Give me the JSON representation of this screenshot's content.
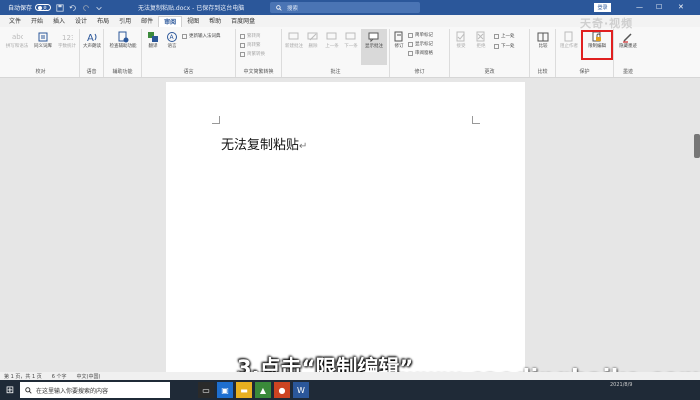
{
  "titlebar": {
    "autosave_label": "自动保存",
    "autosave_state": "关",
    "doc_title": "无法复制粘贴.docx - 已保存到这台电脑",
    "search_placeholder": "搜索",
    "login_label": "登录"
  },
  "tabs": [
    {
      "label": "文件",
      "active": false
    },
    {
      "label": "开始",
      "active": false
    },
    {
      "label": "插入",
      "active": false
    },
    {
      "label": "设计",
      "active": false
    },
    {
      "label": "布局",
      "active": false
    },
    {
      "label": "引用",
      "active": false
    },
    {
      "label": "邮件",
      "active": false
    },
    {
      "label": "审阅",
      "active": true
    },
    {
      "label": "视图",
      "active": false
    },
    {
      "label": "帮助",
      "active": false
    },
    {
      "label": "百度网盘",
      "active": false
    }
  ],
  "ribbon": {
    "proofing": {
      "name": "校对",
      "spelling": "拼写和语法",
      "thesaurus": "同义词库",
      "wordcount": "字数统计"
    },
    "speech": {
      "name": "语音",
      "read_aloud": "大声朗读"
    },
    "accessibility": {
      "name": "辅助功能",
      "check": "检查辅助功能"
    },
    "language": {
      "name": "语言",
      "translate": "翻译",
      "language": "语言",
      "update_input": "更新输入法词典"
    },
    "chinese": {
      "name": "中文简繁转换",
      "to_simplified": "繁转简",
      "to_traditional": "简转繁",
      "convert": "简繁转换"
    },
    "comments": {
      "name": "批注",
      "new": "新建批注",
      "delete": "删除",
      "prev": "上一条",
      "next": "下一条",
      "show": "显示批注"
    },
    "tracking": {
      "name": "修订",
      "track": "修订",
      "simple_markup": "简单标记",
      "show_markup": "显示标记",
      "reviewing_pane": "审阅窗格"
    },
    "changes": {
      "name": "更改",
      "accept": "接受",
      "reject": "拒绝",
      "prev": "上一处",
      "next": "下一处"
    },
    "compare": {
      "name": "比较",
      "compare": "比较"
    },
    "protect": {
      "name": "保护",
      "block_authors": "阻止作者",
      "restrict_editing": "限制编辑"
    },
    "ink": {
      "name": "墨迹",
      "hide_ink": "隐藏墨迹"
    }
  },
  "watermark_top": "天奇·视频",
  "document": {
    "text": "无法复制粘贴",
    "para_mark": "↵"
  },
  "subtitle": "3.点击“限制编辑”",
  "watermark_bottom": "www.caodingbaike.com",
  "status": {
    "page": "第 1 页，共 1 页",
    "words": "6 个字",
    "lang": "中文(中国)"
  },
  "taskbar": {
    "search_placeholder": "在这里输入你要搜索的内容",
    "date": "2021/8/9"
  },
  "colors": {
    "titlebar": "#2b579a",
    "highlight_box": "#e02020"
  }
}
